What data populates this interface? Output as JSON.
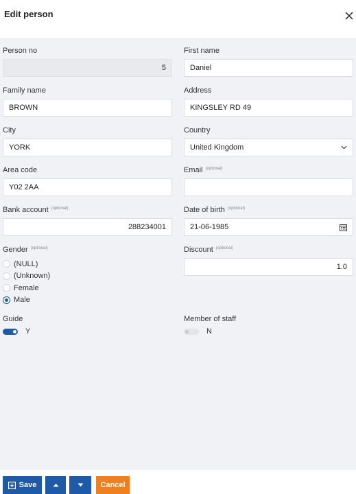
{
  "dialog": {
    "title": "Edit person"
  },
  "fields": {
    "person_no": {
      "label": "Person no",
      "value": "5"
    },
    "first_name": {
      "label": "First name",
      "value": "Daniel"
    },
    "family_name": {
      "label": "Family name",
      "value": "BROWN"
    },
    "address": {
      "label": "Address",
      "value": "KINGSLEY RD 49"
    },
    "city": {
      "label": "City",
      "value": "YORK"
    },
    "country": {
      "label": "Country",
      "value": "United Kingdom"
    },
    "area_code": {
      "label": "Area code",
      "value": "Y02 2AA"
    },
    "email": {
      "label": "Email",
      "optional": "(optional)",
      "value": ""
    },
    "bank_account": {
      "label": "Bank account",
      "optional": "(optional)",
      "value": "288234001"
    },
    "date_of_birth": {
      "label": "Date of birth",
      "optional": "(optional)",
      "value": "21-06-1985"
    },
    "gender": {
      "label": "Gender",
      "optional": "(optional)",
      "options": [
        "(NULL)",
        "(Unknown)",
        "Female",
        "Male"
      ],
      "selected": "Male"
    },
    "discount": {
      "label": "Discount",
      "optional": "(optional)",
      "value": "1.0"
    },
    "guide": {
      "label": "Guide",
      "state": "Y",
      "on": true
    },
    "member_of_staff": {
      "label": "Member of staff",
      "state": "N",
      "on": false
    }
  },
  "buttons": {
    "save": "Save",
    "cancel": "Cancel"
  },
  "colors": {
    "primary": "#1e5aa8",
    "cancel": "#f07f1f",
    "background": "#f1f2f6"
  }
}
